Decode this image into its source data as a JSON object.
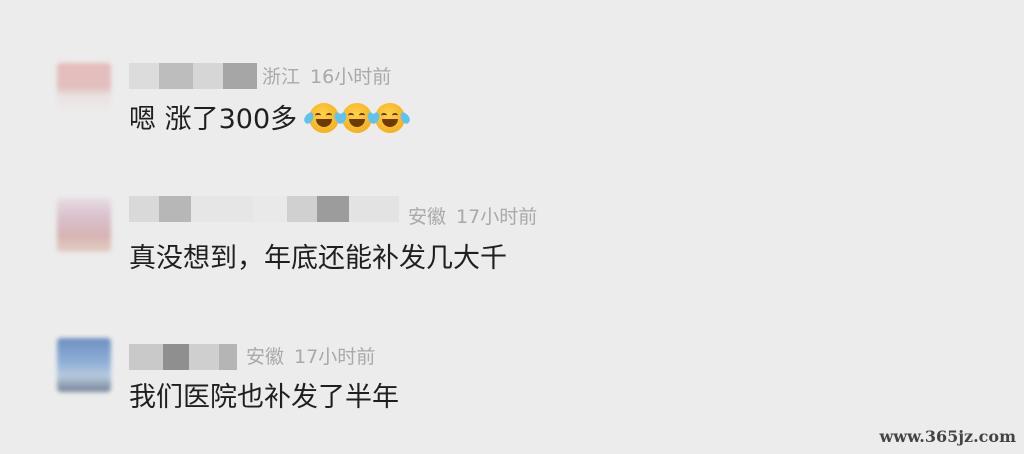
{
  "comments": [
    {
      "location": "浙江",
      "time": "16小时前",
      "content": "嗯 涨了300多",
      "emojis": [
        "laugh-cry-emoji",
        "laugh-cry-emoji",
        "laugh-cry-emoji"
      ]
    },
    {
      "location": "安徽",
      "time": "17小时前",
      "content": "真没想到，年底还能补发几大千"
    },
    {
      "location": "安徽",
      "time": "17小时前",
      "content": "我们医院也补发了半年"
    }
  ],
  "watermark": "www.365jz.com",
  "colors": {
    "background": "#ececec",
    "text": "#1f1f1f",
    "meta": "#a9a9a9"
  }
}
